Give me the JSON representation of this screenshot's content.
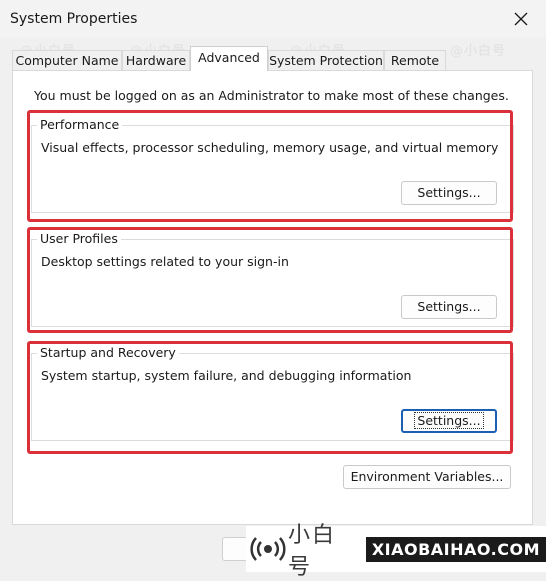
{
  "window": {
    "title": "System Properties",
    "close_icon": "close-icon"
  },
  "tabs": [
    {
      "label": "Computer Name",
      "active": false
    },
    {
      "label": "Hardware",
      "active": false
    },
    {
      "label": "Advanced",
      "active": true
    },
    {
      "label": "System Protection",
      "active": false
    },
    {
      "label": "Remote",
      "active": false
    }
  ],
  "admin_note": "You must be logged on as an Administrator to make most of these changes.",
  "groups": {
    "performance": {
      "title": "Performance",
      "description": "Visual effects, processor scheduling, memory usage, and virtual memory",
      "button": "Settings..."
    },
    "user_profiles": {
      "title": "User Profiles",
      "description": "Desktop settings related to your sign-in",
      "button": "Settings..."
    },
    "startup_recovery": {
      "title": "Startup and Recovery",
      "description": "System startup, system failure, and debugging information",
      "button": "Settings..."
    }
  },
  "env_button": "Environment Variables...",
  "annotation_color": "#d9303a",
  "watermark": {
    "chinese": "小白号",
    "english": "XIAOBAIHAO.COM",
    "background_marks": [
      "@小白号",
      "XIAOBAIHAO.COM"
    ]
  }
}
